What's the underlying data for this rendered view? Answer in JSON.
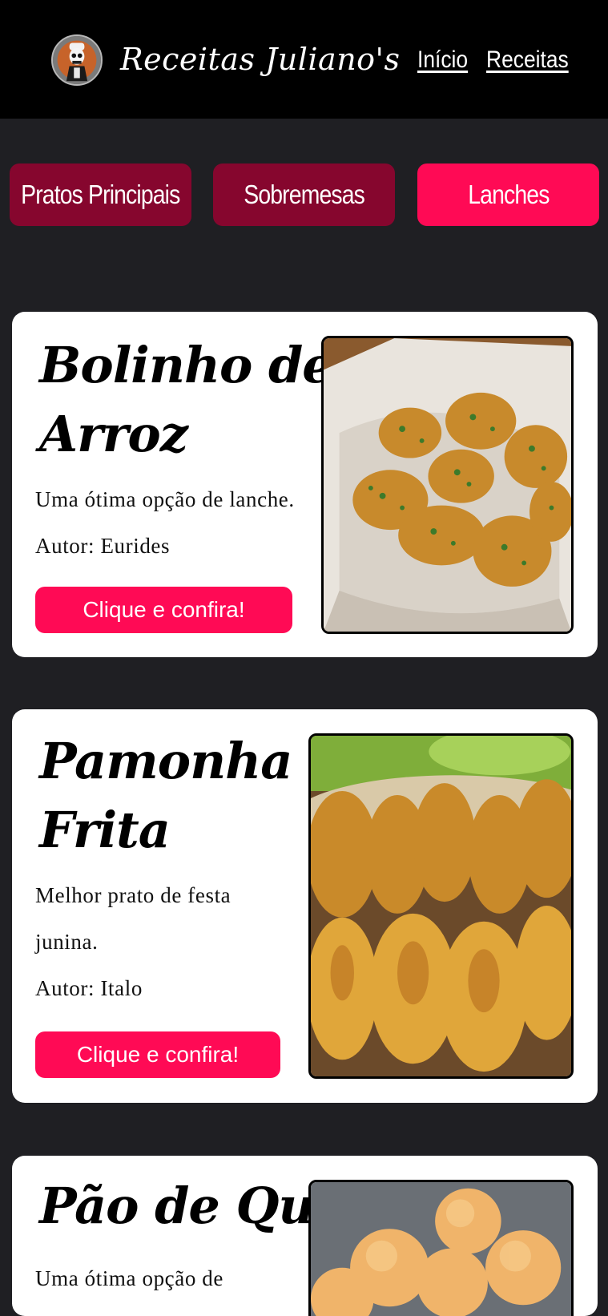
{
  "header": {
    "logo": "chef-skull-logo",
    "brand": "Receitas Juliano's",
    "nav": [
      {
        "label": "Início"
      },
      {
        "label": "Receitas"
      }
    ]
  },
  "categories": [
    {
      "label": "Pratos Principais",
      "active": false
    },
    {
      "label": "Sobremesas",
      "active": false
    },
    {
      "label": "Lanches",
      "active": true
    }
  ],
  "colors": {
    "accent": "#ff0a55",
    "inactive": "#86062e",
    "background": "#1f1f23",
    "header": "#000000"
  },
  "recipes": [
    {
      "title_line1": "Bolinho de",
      "title_line2": "Arroz",
      "description": "Uma ótima opção de lanche.",
      "author": "Autor: Eurides",
      "button": "Clique e confira!",
      "image": "bolinho-de-arroz-photo"
    },
    {
      "title_line1": "Pamonha",
      "title_line2": "Frita",
      "description_line1": "Melhor prato de festa",
      "description_line2": "junina.",
      "author": "Autor: Italo",
      "button": "Clique e confira!",
      "image": "pamonha-frita-photo"
    },
    {
      "title": "Pão de Queijo",
      "description": "Uma ótima opção de",
      "image": "pao-de-queijo-photo"
    }
  ]
}
